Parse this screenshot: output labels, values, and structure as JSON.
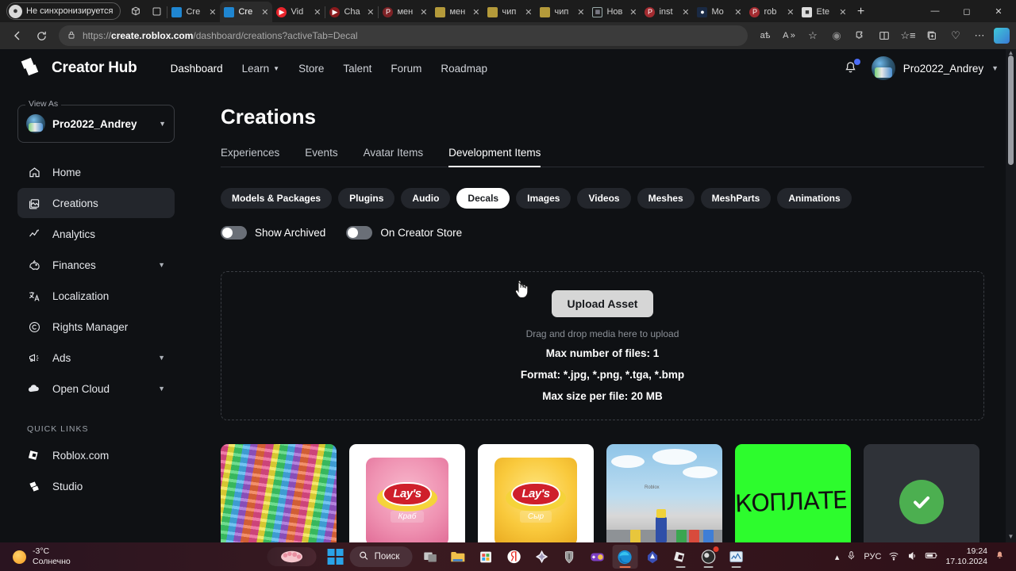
{
  "browser": {
    "profile_pill": "Не синхронизируется",
    "tabs": [
      {
        "title": "Cre",
        "favicon": "roblox-studio-icon",
        "active": false
      },
      {
        "title": "Cre",
        "favicon": "roblox-studio-icon",
        "active": true
      },
      {
        "title": "Vid",
        "favicon": "youtube-icon",
        "active": false
      },
      {
        "title": "Cha",
        "favicon": "youtube-icon",
        "active": false
      },
      {
        "title": "мен",
        "favicon": "pinterest-icon",
        "active": false
      },
      {
        "title": "мен",
        "favicon": "image-icon",
        "active": false
      },
      {
        "title": "чип",
        "favicon": "image-icon",
        "active": false
      },
      {
        "title": "чип",
        "favicon": "image-icon",
        "active": false
      },
      {
        "title": "Нов",
        "favicon": "document-icon",
        "active": false
      },
      {
        "title": "inst",
        "favicon": "pinterest-icon",
        "active": false
      },
      {
        "title": "Mo",
        "favicon": "blue-icon",
        "active": false
      },
      {
        "title": "rob",
        "favicon": "pinterest-icon",
        "active": false
      },
      {
        "title": "Ete",
        "favicon": "roblox-icon",
        "active": false
      }
    ],
    "new_tab_label": "+",
    "window_controls": [
      "minimize",
      "restore",
      "close"
    ],
    "url_scheme": "https://",
    "url_host": "create.roblox.com",
    "url_path": "/dashboard/creations?activeTab=Decal",
    "toolbar_icons": [
      "read-aloud-icon",
      "immersive-reader-icon",
      "favorite-star-icon",
      "browser-essentials-icon",
      "extensions-icon",
      "split-screen-icon",
      "favorites-icon",
      "collections-icon",
      "health-icon",
      "settings-more-icon",
      "copilot-icon"
    ]
  },
  "site_header": {
    "brand": "Creator Hub",
    "nav": [
      {
        "label": "Dashboard",
        "current": true,
        "has_caret": false
      },
      {
        "label": "Learn",
        "current": false,
        "has_caret": true
      },
      {
        "label": "Store",
        "current": false,
        "has_caret": false
      },
      {
        "label": "Talent",
        "current": false,
        "has_caret": false
      },
      {
        "label": "Forum",
        "current": false,
        "has_caret": false
      },
      {
        "label": "Roadmap",
        "current": false,
        "has_caret": false
      }
    ],
    "username": "Pro2022_Andrey"
  },
  "sidebar": {
    "view_as_label": "View As",
    "view_as_user": "Pro2022_Andrey",
    "items": [
      {
        "label": "Home",
        "icon": "home-icon",
        "active": false,
        "expandable": false
      },
      {
        "label": "Creations",
        "icon": "image-stack-icon",
        "active": true,
        "expandable": false
      },
      {
        "label": "Analytics",
        "icon": "analytics-icon",
        "active": false,
        "expandable": false
      },
      {
        "label": "Finances",
        "icon": "piggy-bank-icon",
        "active": false,
        "expandable": true
      },
      {
        "label": "Localization",
        "icon": "translate-icon",
        "active": false,
        "expandable": false
      },
      {
        "label": "Rights Manager",
        "icon": "copyright-icon",
        "active": false,
        "expandable": false
      },
      {
        "label": "Ads",
        "icon": "megaphone-icon",
        "active": false,
        "expandable": true
      },
      {
        "label": "Open Cloud",
        "icon": "cloud-icon",
        "active": false,
        "expandable": true
      }
    ],
    "quick_links_title": "QUICK LINKS",
    "quick_links": [
      {
        "label": "Roblox.com",
        "icon": "roblox-icon"
      },
      {
        "label": "Studio",
        "icon": "roblox-studio-icon"
      }
    ]
  },
  "main": {
    "title": "Creations",
    "tabs": [
      {
        "label": "Experiences",
        "active": false
      },
      {
        "label": "Events",
        "active": false
      },
      {
        "label": "Avatar Items",
        "active": false
      },
      {
        "label": "Development Items",
        "active": true
      }
    ],
    "chips": [
      {
        "label": "Models & Packages",
        "selected": false
      },
      {
        "label": "Plugins",
        "selected": false
      },
      {
        "label": "Audio",
        "selected": false
      },
      {
        "label": "Decals",
        "selected": true
      },
      {
        "label": "Images",
        "selected": false
      },
      {
        "label": "Videos",
        "selected": false
      },
      {
        "label": "Meshes",
        "selected": false
      },
      {
        "label": "MeshParts",
        "selected": false
      },
      {
        "label": "Animations",
        "selected": false
      }
    ],
    "toggles": [
      {
        "label": "Show Archived",
        "on": false
      },
      {
        "label": "On Creator Store",
        "on": false
      }
    ],
    "dropzone": {
      "button_label": "Upload Asset",
      "hint": "Drag and drop media here to upload",
      "max_files": "Max number of files: 1",
      "formats": "Format: *.jpg, *.png, *.tga, *.bmp",
      "max_size": "Max size per file: 20 MB"
    },
    "cards": [
      {
        "kind": "pattern",
        "alt": "colorful-striped-decal"
      },
      {
        "kind": "lays-pink",
        "flavor": "Краб",
        "brand": "Lay's"
      },
      {
        "kind": "lays-yellow",
        "flavor": "Сыр",
        "brand": "Lay's"
      },
      {
        "kind": "scene",
        "alt": "roblox-game-screenshot"
      },
      {
        "kind": "green-text",
        "text": "КОПЛАТЕ"
      },
      {
        "kind": "check",
        "alt": "green-checkmark"
      }
    ]
  },
  "taskbar": {
    "weather_temp": "-3°C",
    "weather_desc": "Солнечно",
    "search_placeholder": "Поиск",
    "apps": [
      "task-view-icon",
      "file-explorer-icon",
      "microsoft-store-icon",
      "yandex-browser-icon",
      "diamond-game-icon",
      "world-of-tanks-icon",
      "game-controller-icon",
      "microsoft-edge-icon",
      "valorant-icon",
      "roblox-icon",
      "obs-studio-icon",
      "task-manager-icon"
    ],
    "tray": {
      "language": "РУС",
      "time": "19:24",
      "date": "17.10.2024",
      "icons": [
        "chevron-up-icon",
        "microphone-icon",
        "wifi-icon",
        "volume-icon",
        "battery-icon",
        "notification-bell-icon"
      ]
    }
  },
  "colors": {
    "page_bg": "#0f1114",
    "accent": "#ffffff",
    "chip_bg": "#23262c",
    "green": "#4caf50"
  }
}
